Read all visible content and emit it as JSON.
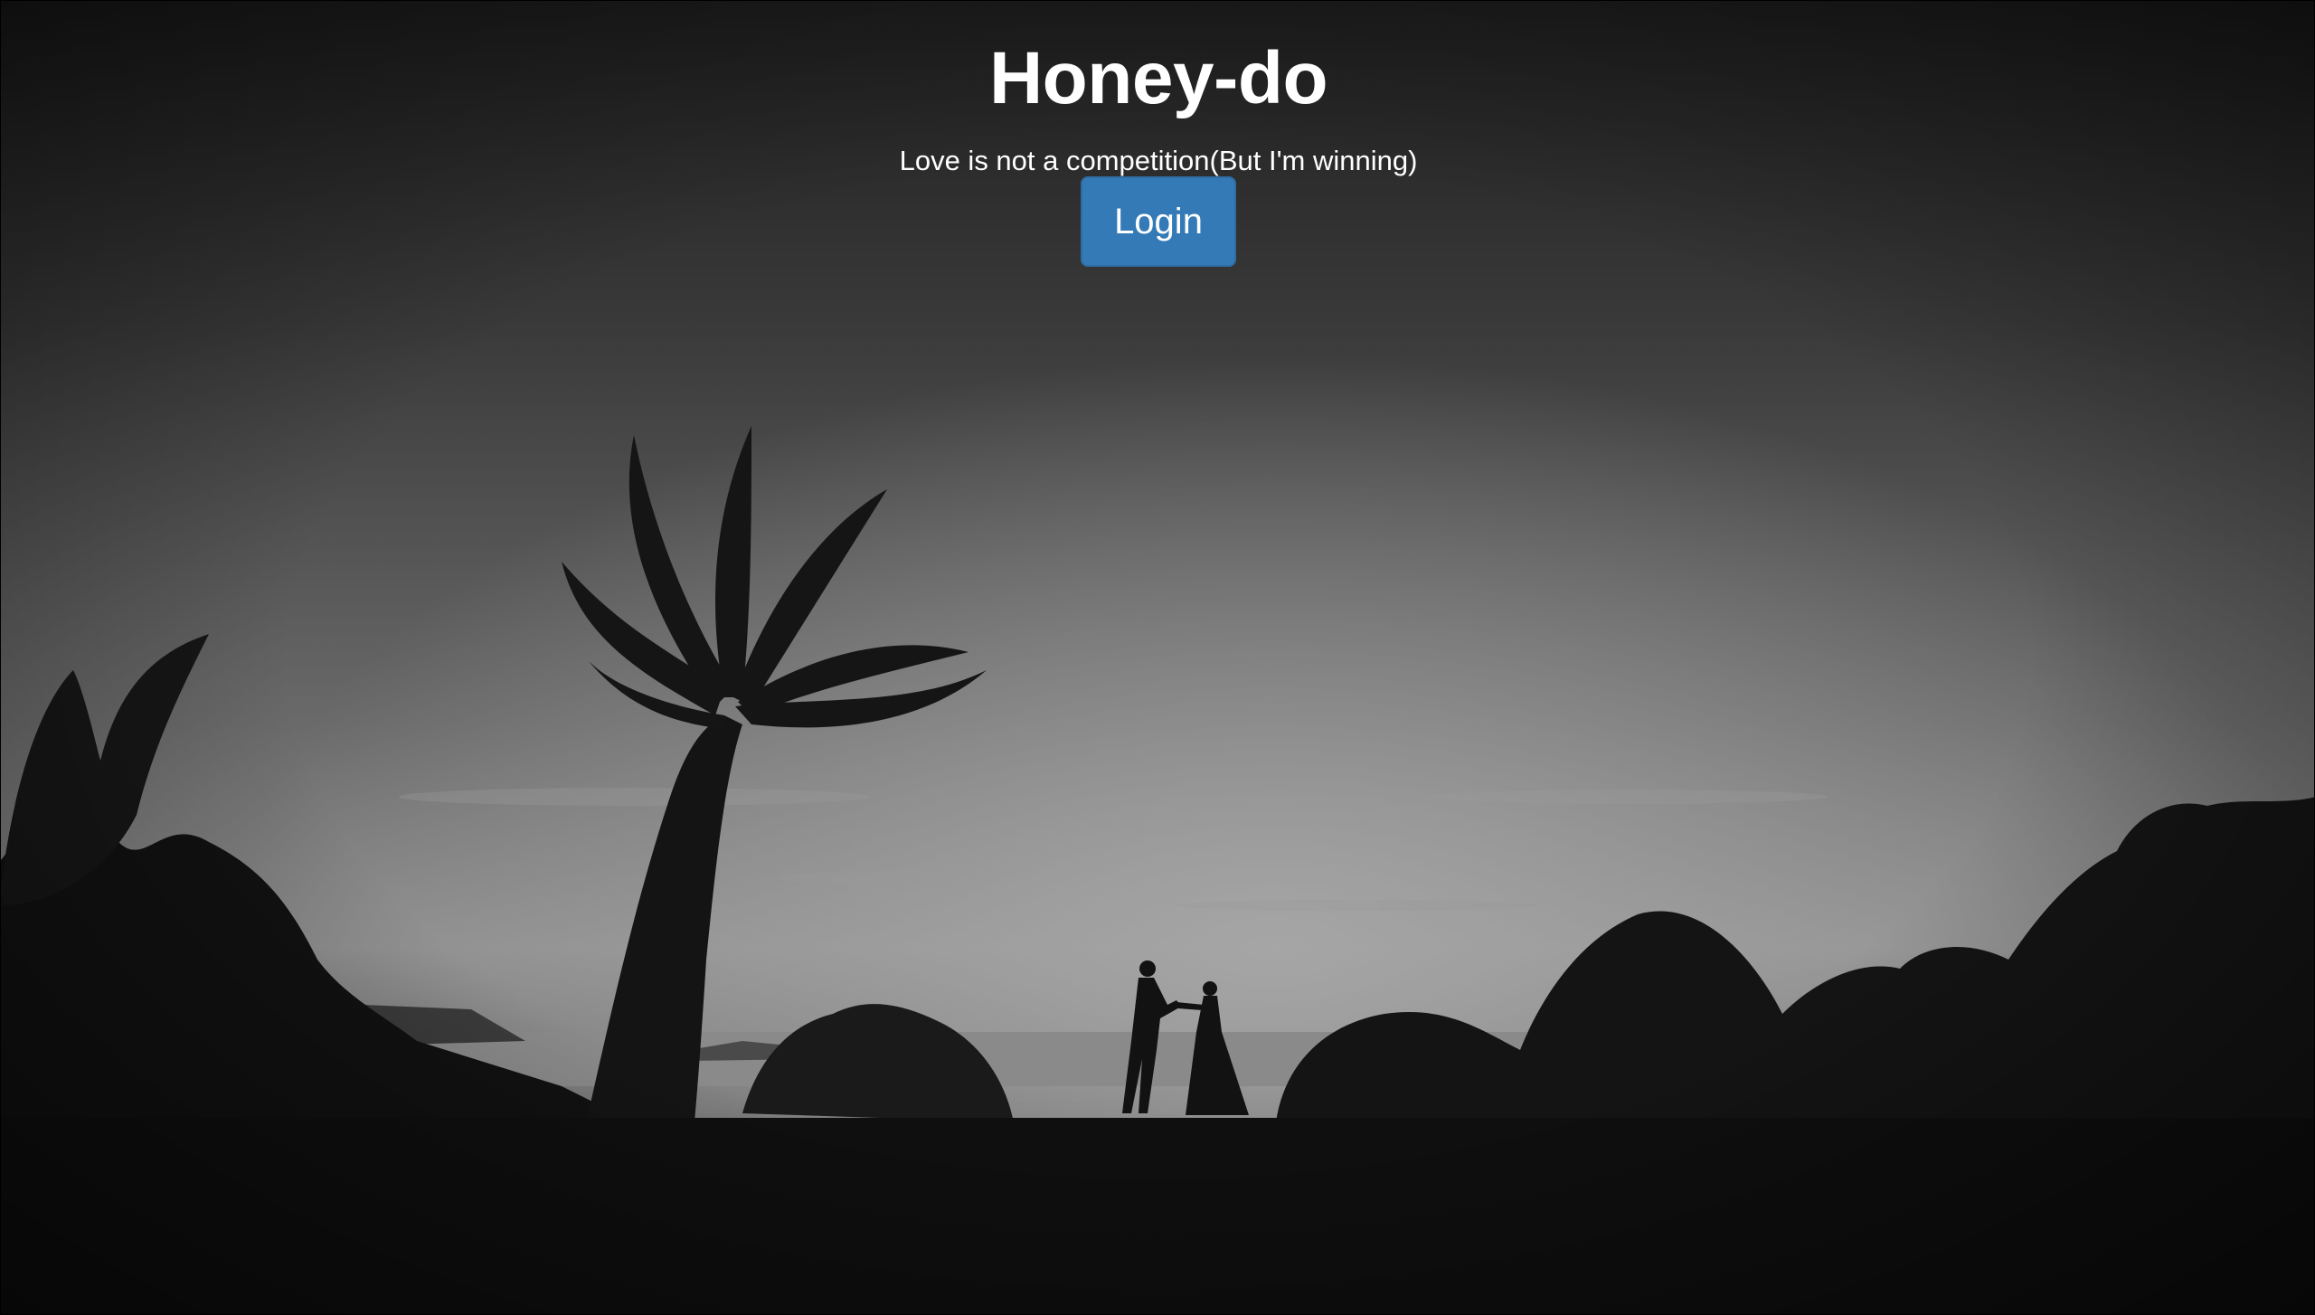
{
  "hero": {
    "title": "Honey-do",
    "tagline": "Love is not a competition(But I'm winning)",
    "login_label": "Login"
  },
  "colors": {
    "button_bg": "#337ab7",
    "button_border": "#2e6da4",
    "text": "#ffffff"
  },
  "background": {
    "description_icon": "palm-tree-sunset-couple-photo"
  }
}
